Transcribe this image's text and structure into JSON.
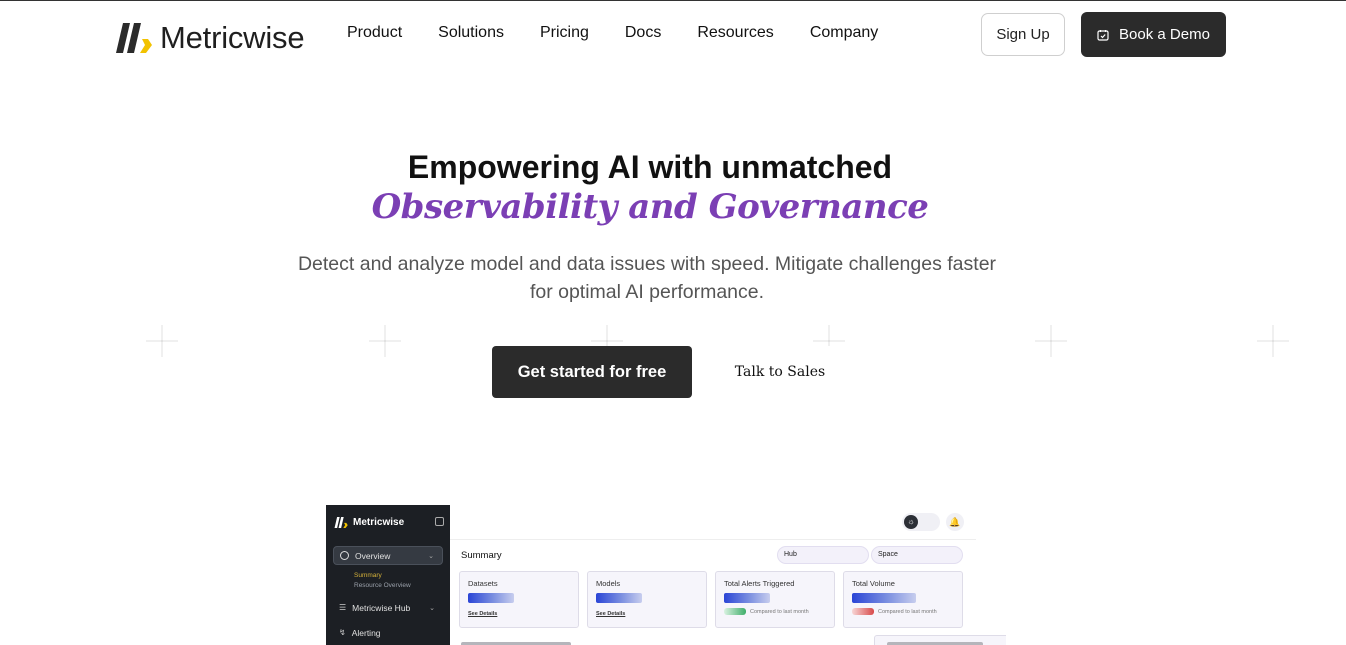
{
  "brand": {
    "name": "Metricwise",
    "logo_colors": {
      "dark": "#2b2b2b",
      "accent": "#f2c200"
    }
  },
  "nav": {
    "links": [
      "Product",
      "Solutions",
      "Pricing",
      "Docs",
      "Resources",
      "Company"
    ],
    "signup_label": "Sign Up",
    "demo_label": "Book a Demo",
    "demo_icon": "calendar-check-icon"
  },
  "hero": {
    "title": "Empowering AI with unmatched",
    "accent": "Observability and Governance",
    "accent_color": "#7b3fb4",
    "subtitle": "Detect and analyze model and data issues with speed. Mitigate challenges faster for optimal AI performance.",
    "cta_primary": "Get started for free",
    "cta_secondary": "Talk to Sales"
  },
  "dashboard": {
    "brand": "Metricwise",
    "sidebar": {
      "overview": "Overview",
      "sub_items": [
        "Summary",
        "Resource Overview"
      ],
      "hub": "Metricwise Hub",
      "alerting": "Alerting"
    },
    "title": "Summary",
    "filters": [
      "Hub",
      "Space"
    ],
    "cards": [
      {
        "title": "Datasets",
        "link": "See Details"
      },
      {
        "title": "Models",
        "link": "See Details"
      },
      {
        "title": "Total Alerts Triggered",
        "compare": "Compared to last month",
        "trend": "up"
      },
      {
        "title": "Total Volume",
        "compare": "Compared to last month",
        "trend": "down"
      }
    ],
    "colors": {
      "sidebar": "#1c1f24",
      "highlight": "#d4b13a",
      "bar": "#2a45d6"
    }
  }
}
